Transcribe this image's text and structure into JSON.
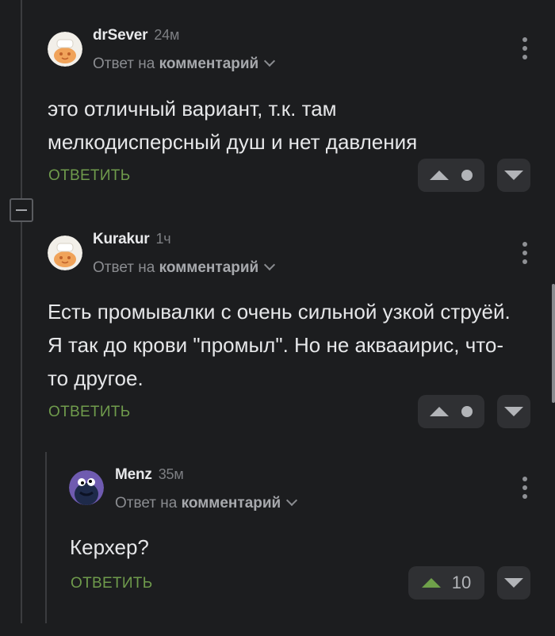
{
  "comments": [
    {
      "author": "drSever",
      "time": "24м",
      "reply_prefix": "Ответ на",
      "reply_target": "комментарий",
      "text": "это отличный вариант, т.к. там мелкодисперсный душ и нет давления",
      "reply_label": "ОТВЕТИТЬ",
      "avatar_icon": "pikabu-default-avatar-icon"
    },
    {
      "author": "Kurakur",
      "time": "1ч",
      "reply_prefix": "Ответ на",
      "reply_target": "комментарий",
      "text": "Есть промывалки с очень сильной узкой струёй. Я так до крови \"промыл\". Но не аквааирис, что-то другое.",
      "reply_label": "ОТВЕТИТЬ",
      "avatar_icon": "pikabu-default-avatar-icon"
    },
    {
      "author": "Menz",
      "time": "35м",
      "reply_prefix": "Ответ на",
      "reply_target": "комментарий",
      "text": "Керхер?",
      "reply_label": "ОТВЕТИТЬ",
      "rating": "10",
      "avatar_icon": "cookie-monster-avatar-icon"
    }
  ],
  "colors": {
    "background": "#1c1d1f",
    "reply_green": "#6f9b4c",
    "upvote_green": "#6fa14a",
    "button_bg": "#2f3033"
  }
}
